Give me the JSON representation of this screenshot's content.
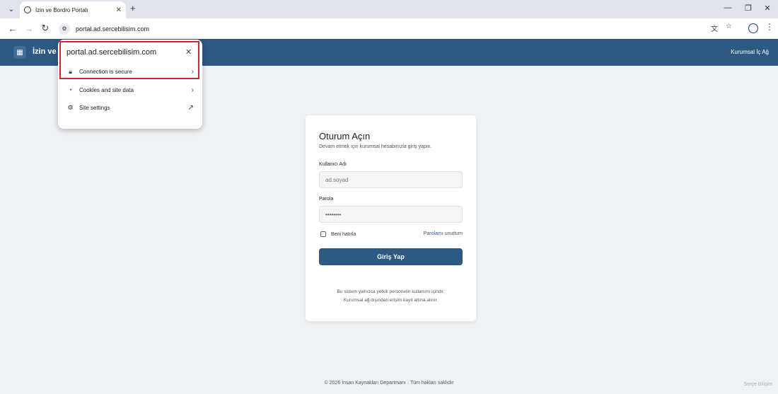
{
  "browser": {
    "tab_title": "İzin ve Bordro Portalı",
    "url": "portal.ad.sercebilisim.com"
  },
  "popup": {
    "host": "portal.ad.sercebilisim.com",
    "connection_label": "Connection is secure",
    "cookies_label": "Cookies and site data",
    "settings_label": "Site settings"
  },
  "app": {
    "title": "İzin ve B",
    "header_right": "Kurumsal İç Ağ"
  },
  "login": {
    "title": "Oturum Açın",
    "subtitle": "Devam etmek için kurumsal hesabınızla giriş yapın.",
    "username_label": "Kullanıcı Adı",
    "username_value": "ad.soyad",
    "password_label": "Parola",
    "password_value": "sifre123",
    "remember_label": "Beni hatırla",
    "forgot_label": "Parolamı unuttum",
    "submit_label": "Giriş Yap",
    "note_line1": "Bu sistem yalnızca yetkili personelin kullanımı içindir.",
    "note_line2": "Kurumsal ağ dışından erişim kayıt altına alınır."
  },
  "footer": {
    "text": "© 2026 İnsan Kaynakları Departmanı · Tüm hakları saklıdır",
    "brand": "Serçe Bilişim"
  },
  "colors": {
    "header": "#2c5a83",
    "highlight": "#d9232d",
    "background": "#eef1f5"
  }
}
